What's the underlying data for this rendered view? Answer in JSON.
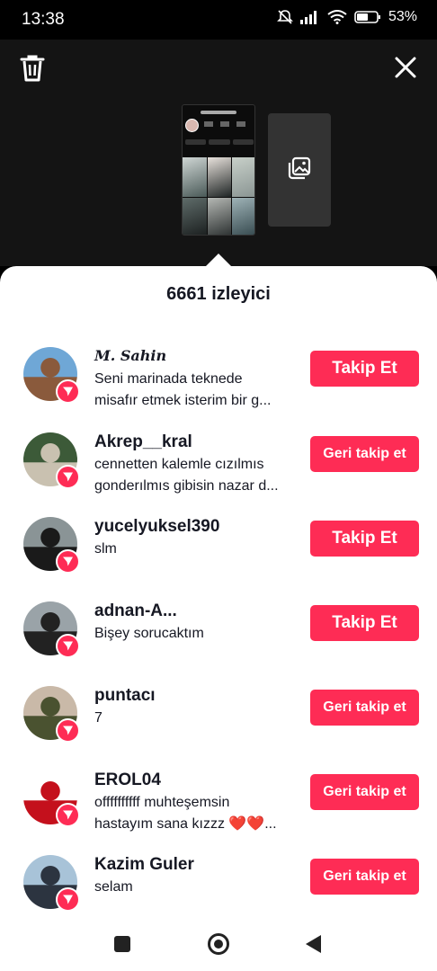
{
  "status_bar": {
    "time": "13:38",
    "battery": "53%",
    "icons": [
      "bell-off-icon",
      "signal-icon",
      "wifi-icon",
      "battery-icon"
    ]
  },
  "top_bar": {
    "icons": [
      "trash-icon",
      "close-icon",
      "add-image-icon"
    ]
  },
  "sheet": {
    "title": "6661 izleyici"
  },
  "viewers": [
    {
      "name": "𝑴. 𝑺𝒂𝒉𝒊𝒏",
      "message_lines": [
        "Seni marinada teknede",
        "misafır etmek isterim bir g..."
      ],
      "button": "Takip Et",
      "avatar_colors": [
        "#6fa7d6",
        "#8a5a3c"
      ]
    },
    {
      "name": "Akrep__kral",
      "message_lines": [
        "cennetten kalemle cızılmıs",
        "gonderılmıs gibisin nazar d..."
      ],
      "button": "Geri takip et",
      "avatar_colors": [
        "#3c5a38",
        "#c9c1b0"
      ]
    },
    {
      "name": "yucelyuksel390",
      "message_lines": [
        "slm"
      ],
      "button": "Takip Et",
      "avatar_colors": [
        "#8a9496",
        "#1a1a1a"
      ]
    },
    {
      "name": "adnan-A...",
      "message_lines": [
        "Bişey sorucaktım"
      ],
      "button": "Takip Et",
      "avatar_colors": [
        "#9aa3a8",
        "#222"
      ]
    },
    {
      "name": "puntacı",
      "message_lines": [
        "7"
      ],
      "button": "Geri takip et",
      "avatar_colors": [
        "#c9b9a8",
        "#4a5230"
      ]
    },
    {
      "name": "EROL04",
      "message_lines": [
        "offffffffff muhteşemsin",
        "hastayım sana kızzz ❤️❤️..."
      ],
      "button": "Geri takip et",
      "avatar_colors": [
        "#ffffff",
        "#c4101c"
      ]
    },
    {
      "name": "Kazim Guler",
      "message_lines": [
        "selam"
      ],
      "button": "Geri takip et",
      "avatar_colors": [
        "#a8c3d8",
        "#2c3440"
      ]
    }
  ],
  "colors": {
    "accent": "#fe2c55",
    "text": "#161823",
    "top_background": "#141414"
  }
}
